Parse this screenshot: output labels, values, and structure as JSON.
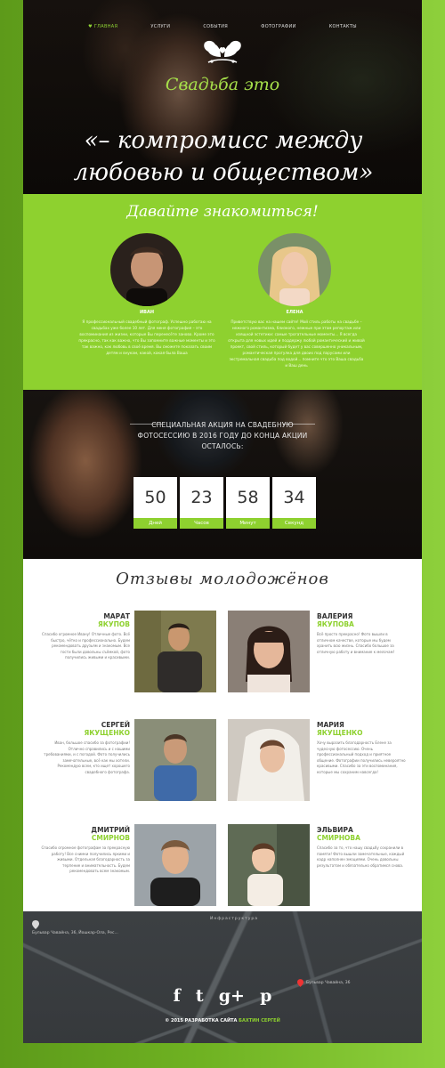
{
  "nav": {
    "items": [
      {
        "label": "♥ ГЛАВНАЯ",
        "active": true
      },
      {
        "label": "УСЛУГИ",
        "active": false
      },
      {
        "label": "СОБЫТИЯ",
        "active": false
      },
      {
        "label": "ФОТОГРАФИИ",
        "active": false
      },
      {
        "label": "КОНТАКТЫ",
        "active": false
      }
    ]
  },
  "hero": {
    "subtitle": "Свадьба это",
    "quote": "«– компромисс между любовью и обществом»"
  },
  "about": {
    "title": "Давайте знакомиться!",
    "people": [
      {
        "name": "ИВАН",
        "bio": "Я профессиональный свадебный фотограф. Успешно работаю на свадьбах уже более 10 лет. Для меня фотография – это воспоминания из жизни, которые Вы перенесёте заново. Кроме это прекрасно, так как важно, что Вы запомните важные моменты и это так важно, как любовь в своё время. Вы сможете показать своим детям и внукам, какой, какая была Ваша"
      },
      {
        "name": "ЕЛЕНА",
        "bio": "Приветствую вас на нашем сайте! Мой стиль работы на свадьбе – нежного романтизма, близкого, нежные при этом репортаж или изящной эстетики: самые трогательные моменты... Я всегда открыта для новых идей и поддержу любой романтический и живой проект, свой стиль, который будет у вас совершенно уникальным, романтическая прогулка для двоих под парусами или экстремальная свадьба под водой... помните что это Ваша свадьба и Ваш день"
      }
    ]
  },
  "promo": {
    "text": "СПЕЦИАЛЬНАЯ АКЦИЯ НА СВАДЕБНУЮ ФОТОСЕССИЮ В 2016 ГОДУ ДО КОНЦА АКЦИИ ОСТАЛОСЬ:",
    "counters": [
      {
        "value": "50",
        "label": "Дней"
      },
      {
        "value": "23",
        "label": "Часов"
      },
      {
        "value": "58",
        "label": "Минут"
      },
      {
        "value": "34",
        "label": "Секунд"
      }
    ]
  },
  "reviews": {
    "title": "Отзывы молодожёнов",
    "items": [
      {
        "first": "МАРАТ",
        "last": "ЯКУПОВ",
        "side": "left",
        "text": "Спасибо огромное Ивану! Отличные фото. Всё быстро, чётко и профессионально. Будем рекомендовать друзьям и знакомым. Все гости были довольны съёмкой, фото получились живыми и красивыми."
      },
      {
        "first": "ВАЛЕРИЯ",
        "last": "ЯКУПОВА",
        "side": "right",
        "text": "Всё просто прекрасно! Фото вышли в отличном качестве, которые мы будем хранить всю жизнь. Спасибо большое за отличную работу и внимание к мелочам!"
      },
      {
        "first": "СЕРГЕЙ",
        "last": "ЯКУЩЕНКО",
        "side": "left",
        "text": "Иван, большое спасибо за фотографии! Отлично справились и с нашими требованиями, и с погодой. Фото получились замечательные, всё как мы хотели. Рекомендую всем, кто ищет хорошего свадебного фотографа."
      },
      {
        "first": "МАРИЯ",
        "last": "ЯКУЩЕНКО",
        "side": "right",
        "text": "Хочу выразить благодарность Елене за чудесную фотосессию. Очень профессиональный подход и приятное общение. Фотографии получились невероятно красивыми. Спасибо за эти воспоминания, которые мы сохраним навсегда!"
      },
      {
        "first": "ДМИТРИЙ",
        "last": "СМИРНОВ",
        "side": "left",
        "text": "Спасибо огромное фотографам за прекрасную работу! Все снимки получились яркими и живыми. Отдельная благодарность за терпение и внимательность. Будем рекомендовать всем знакомым."
      },
      {
        "first": "ЭЛЬВИРА",
        "last": "СМИРНОВА",
        "side": "right",
        "text": "Спасибо за то, что нашу свадьбу сохранили в памяти! Фото вышли замечательные, каждый кадр наполнен эмоциями. Очень довольны результатом и обязательно обратимся снова."
      }
    ]
  },
  "footer": {
    "map_labels": [
      "Бульвар Чавайна, 36, Йошкар-Ола, Рес...",
      "Бульвар Чавайна, 36",
      "Инфраструктура"
    ],
    "social": [
      "f",
      "t",
      "g+",
      "p"
    ],
    "copyright_prefix": "© 2015 РАЗРАБОТКА САЙТА",
    "copyright_author": "БАХТИН СЕРГЕЙ"
  },
  "colors": {
    "accent": "#8ed12f",
    "dark": "#1a1410",
    "background": "#6fb222"
  }
}
